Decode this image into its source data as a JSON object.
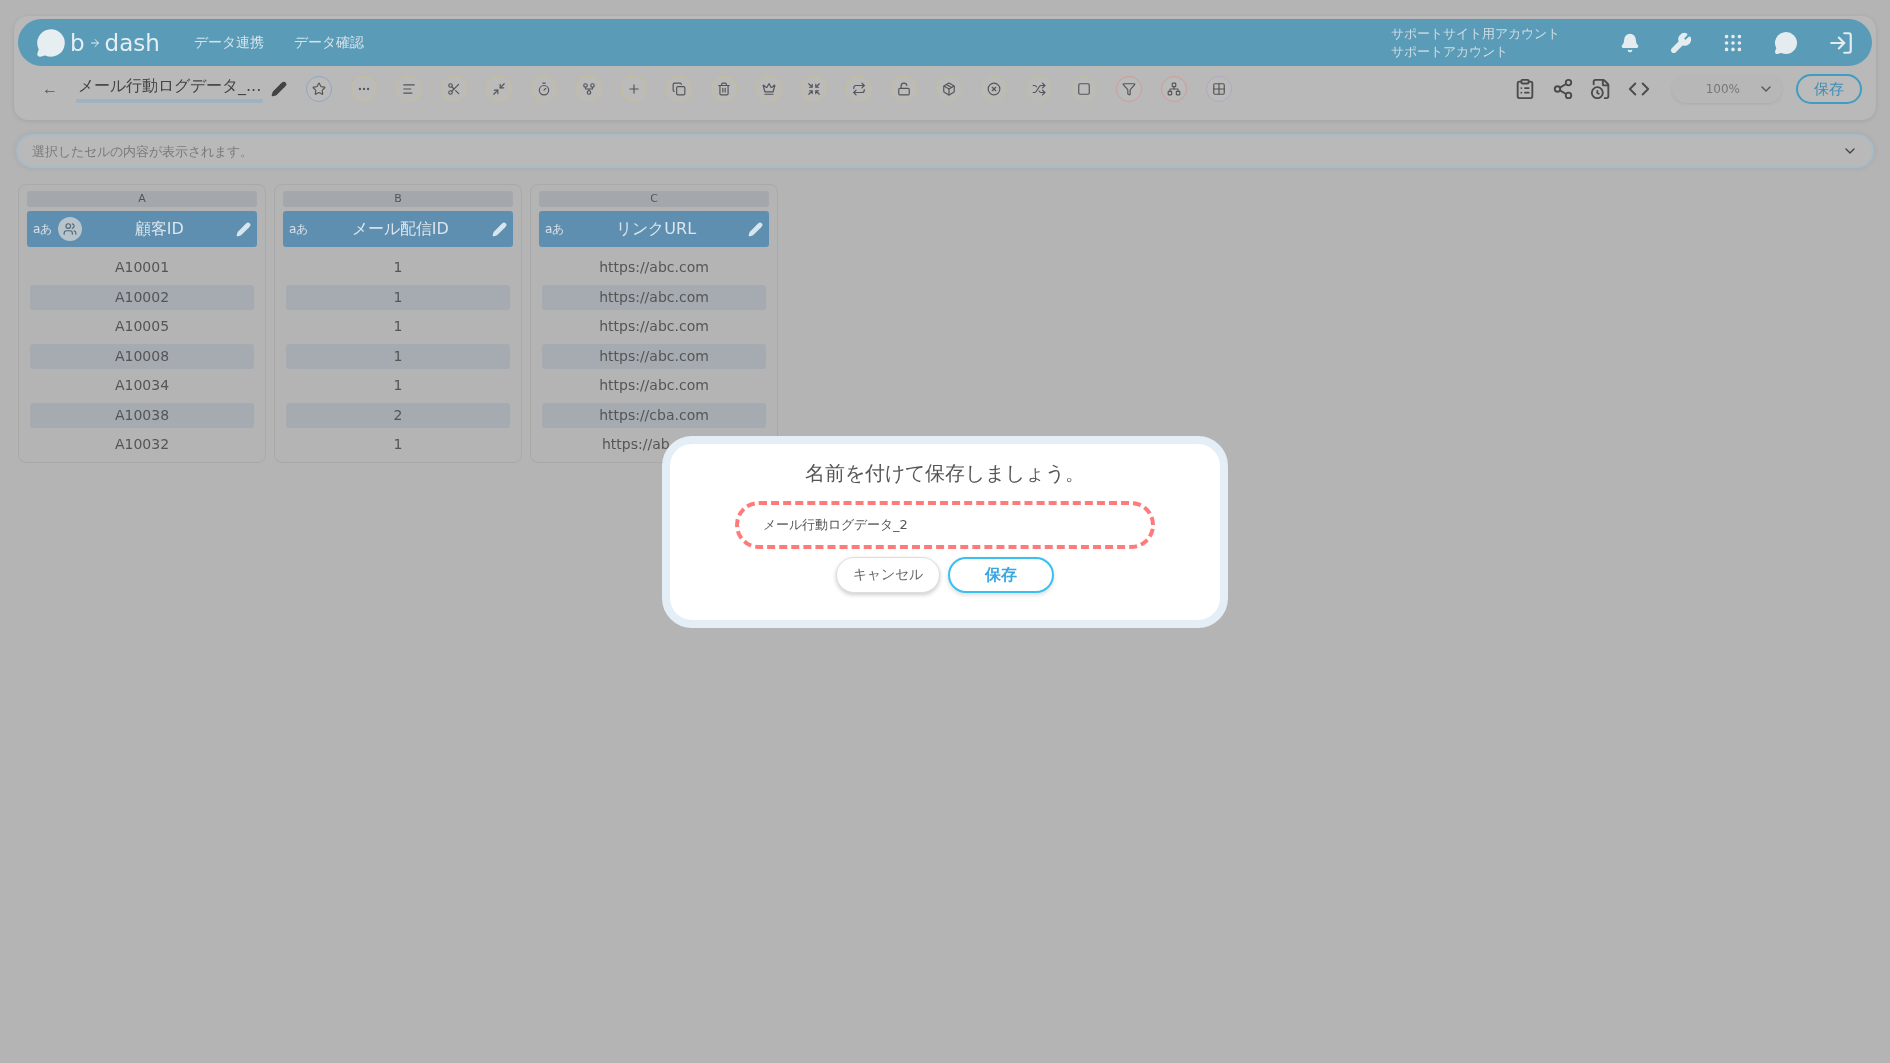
{
  "header": {
    "logo_parts": [
      "b",
      "dash"
    ],
    "nav": [
      "データ連携",
      "データ確認"
    ],
    "account": [
      "サポートサイト用アカウント",
      "サポートアカウント"
    ]
  },
  "toolbar": {
    "back": "←",
    "title": "メール行動ログデータ_...",
    "zoom": "100%",
    "save": "保存"
  },
  "formula_bar": {
    "placeholder": "選択したセルの内容が表示されます。"
  },
  "columns": [
    {
      "letter": "A",
      "name": "顧客ID",
      "type_label": "aあ",
      "key": true,
      "cells": [
        {
          "text": "A10001"
        },
        {
          "text": "A10002"
        },
        {
          "text": "A10005"
        },
        {
          "text": "A10008"
        },
        {
          "text": "A10034"
        },
        {
          "text": "A10038"
        },
        {
          "text": "A10032"
        }
      ]
    },
    {
      "letter": "B",
      "name": "メール配信ID",
      "type_label": "aあ",
      "key": false,
      "cells": [
        {
          "text": "1"
        },
        {
          "text": "1"
        },
        {
          "text": "1"
        },
        {
          "text": "1"
        },
        {
          "text": "1"
        },
        {
          "text": "2"
        },
        {
          "text": "1"
        }
      ]
    },
    {
      "letter": "C",
      "name": "リンクURL",
      "type_label": "aあ",
      "key": false,
      "cells": [
        {
          "text": "https://abc.com"
        },
        {
          "text": "https://abc.com"
        },
        {
          "text": "https://abc.com"
        },
        {
          "text": "https://abc.com"
        },
        {
          "text": "https://abc.com"
        },
        {
          "text": "https://cba.com"
        },
        {
          "text": "https://ab",
          "cut": true
        }
      ]
    }
  ],
  "dialog": {
    "message": "名前を付けて保存しましょう。",
    "value": "メール行動ログデータ_2",
    "cancel": "キャンセル",
    "save": "保存"
  }
}
